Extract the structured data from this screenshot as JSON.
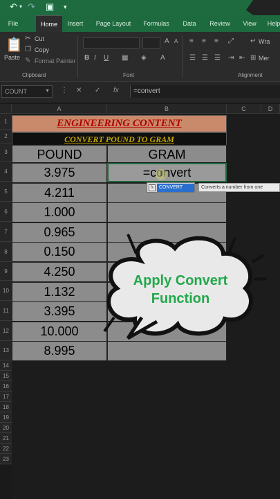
{
  "quick_access": {
    "undo_icon": "undo-icon",
    "redo_icon": "redo-icon",
    "save_icon": "save-icon"
  },
  "ribbon_tabs": [
    "File",
    "Home",
    "Insert",
    "Page Layout",
    "Formulas",
    "Data",
    "Review",
    "View",
    "Help"
  ],
  "active_tab": "Home",
  "clipboard": {
    "cut": "Cut",
    "copy": "Copy",
    "format_painter": "Format Painter",
    "paste": "Paste",
    "group_label": "Clipboard"
  },
  "font_group_label": "Font",
  "alignment_group": {
    "wrap_label": "Wra",
    "merge_label": "Mer",
    "group_label": "Alignment"
  },
  "formula_bar": {
    "name_box": "COUNT",
    "cancel": "✕",
    "enter": "✓",
    "fx": "fx",
    "value": "=convert"
  },
  "columns": [
    "A",
    "B",
    "C",
    "D"
  ],
  "rows": [
    "1",
    "2",
    "3",
    "4",
    "5",
    "6",
    "7",
    "8",
    "9",
    "10",
    "11",
    "12",
    "13",
    "14",
    "15",
    "16",
    "17",
    "18",
    "19",
    "20",
    "21",
    "22",
    "23"
  ],
  "sheet": {
    "title": "ENGINEERING CONTENT",
    "subtitle": "CONVERT POUND TO GRAM",
    "header_pound": "POUND",
    "header_gram": "GRAM",
    "pounds": [
      "3.975",
      "4.211",
      "1.000",
      "0.965",
      "0.150",
      "4.250",
      "1.132",
      "3.395",
      "10.000",
      "8.995"
    ],
    "active_cell_text": "=convert"
  },
  "autocomplete": {
    "item": "CONVERT",
    "tooltip": "Converts a number from one"
  },
  "callout": {
    "line1": "Apply Convert",
    "line2": "Function"
  }
}
